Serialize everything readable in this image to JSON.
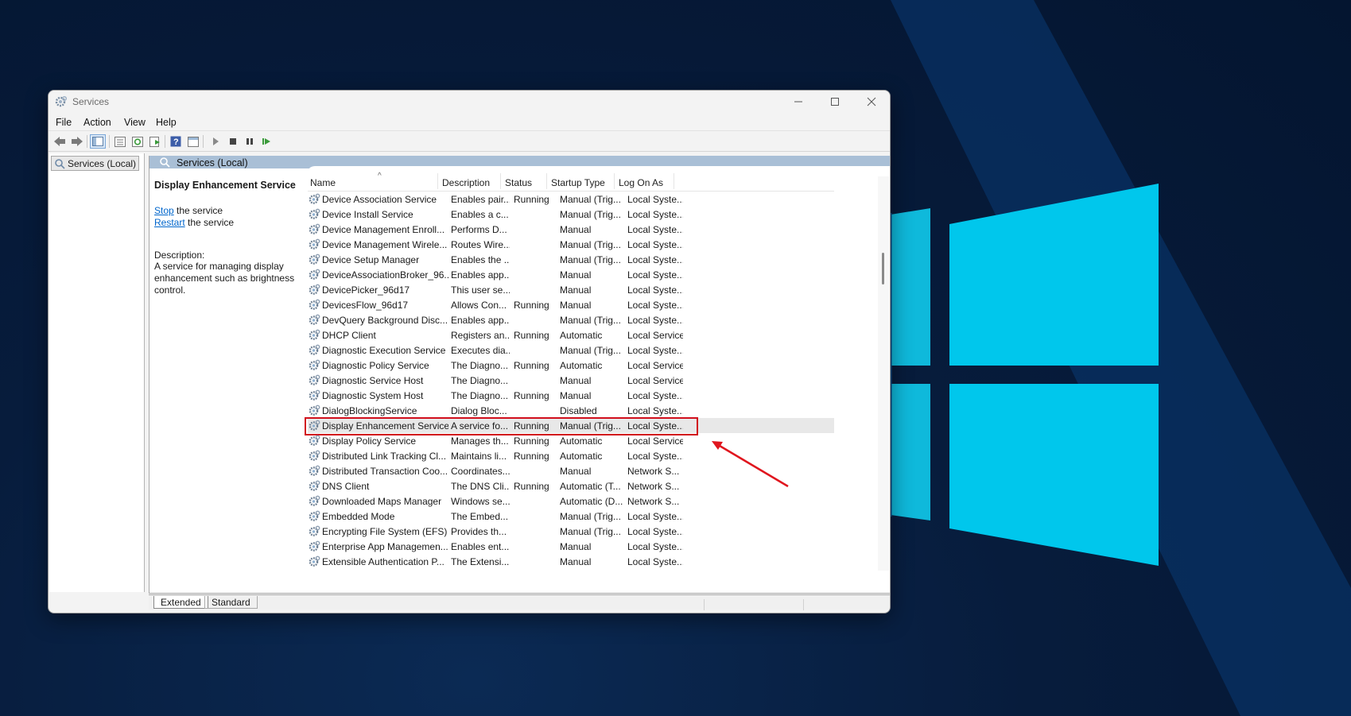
{
  "colors": {
    "accent_blue": "#0066cc",
    "highlight_red": "#d10f1c",
    "desktop_bg": "#041530",
    "logo_cyan": "#00c7ec"
  },
  "window": {
    "title": "Services",
    "icons": {
      "app": "services-gear-icon",
      "minimize": "minimize-icon",
      "maximize": "maximize-icon",
      "close": "close-icon"
    }
  },
  "menu": [
    "File",
    "Action",
    "View",
    "Help"
  ],
  "toolbar": {
    "buttons": [
      "back-icon",
      "forward-icon",
      "show-hide-console-tree-icon",
      "properties-icon",
      "refresh-icon",
      "export-list-icon",
      "help-icon",
      "console-view-icon",
      "start-service-icon",
      "stop-service-icon",
      "pause-service-icon",
      "restart-service-icon"
    ]
  },
  "tree": {
    "root_label": "Services (Local)"
  },
  "pane": {
    "title": "Services (Local)"
  },
  "details": {
    "service_title": "Display Enhancement Service",
    "stop_link": "Stop",
    "stop_suffix": " the service",
    "restart_link": "Restart",
    "restart_suffix": " the service",
    "description_label": "Description:",
    "description": "A service for managing display enhancement such as brightness control."
  },
  "columns": [
    "Name",
    "Description",
    "Status",
    "Startup Type",
    "Log On As"
  ],
  "services": [
    {
      "name": "Device Association Service",
      "desc": "Enables pair...",
      "status": "Running",
      "startup": "Manual (Trig...",
      "logon": "Local Syste..."
    },
    {
      "name": "Device Install Service",
      "desc": "Enables a c...",
      "status": "",
      "startup": "Manual (Trig...",
      "logon": "Local Syste..."
    },
    {
      "name": "Device Management Enroll...",
      "desc": "Performs D...",
      "status": "",
      "startup": "Manual",
      "logon": "Local Syste..."
    },
    {
      "name": "Device Management Wirele...",
      "desc": "Routes Wire...",
      "status": "",
      "startup": "Manual (Trig...",
      "logon": "Local Syste..."
    },
    {
      "name": "Device Setup Manager",
      "desc": "Enables the ...",
      "status": "",
      "startup": "Manual (Trig...",
      "logon": "Local Syste..."
    },
    {
      "name": "DeviceAssociationBroker_96...",
      "desc": "Enables app...",
      "status": "",
      "startup": "Manual",
      "logon": "Local Syste..."
    },
    {
      "name": "DevicePicker_96d17",
      "desc": "This user se...",
      "status": "",
      "startup": "Manual",
      "logon": "Local Syste..."
    },
    {
      "name": "DevicesFlow_96d17",
      "desc": "Allows Con...",
      "status": "Running",
      "startup": "Manual",
      "logon": "Local Syste..."
    },
    {
      "name": "DevQuery Background Disc...",
      "desc": "Enables app...",
      "status": "",
      "startup": "Manual (Trig...",
      "logon": "Local Syste..."
    },
    {
      "name": "DHCP Client",
      "desc": "Registers an...",
      "status": "Running",
      "startup": "Automatic",
      "logon": "Local Service"
    },
    {
      "name": "Diagnostic Execution Service",
      "desc": "Executes dia...",
      "status": "",
      "startup": "Manual (Trig...",
      "logon": "Local Syste..."
    },
    {
      "name": "Diagnostic Policy Service",
      "desc": "The Diagno...",
      "status": "Running",
      "startup": "Automatic",
      "logon": "Local Service"
    },
    {
      "name": "Diagnostic Service Host",
      "desc": "The Diagno...",
      "status": "",
      "startup": "Manual",
      "logon": "Local Service"
    },
    {
      "name": "Diagnostic System Host",
      "desc": "The Diagno...",
      "status": "Running",
      "startup": "Manual",
      "logon": "Local Syste..."
    },
    {
      "name": "DialogBlockingService",
      "desc": "Dialog Bloc...",
      "status": "",
      "startup": "Disabled",
      "logon": "Local Syste..."
    },
    {
      "name": "Display Enhancement Service",
      "desc": "A service fo...",
      "status": "Running",
      "startup": "Manual (Trig...",
      "logon": "Local Syste...",
      "selected": true
    },
    {
      "name": "Display Policy Service",
      "desc": "Manages th...",
      "status": "Running",
      "startup": "Automatic",
      "logon": "Local Service"
    },
    {
      "name": "Distributed Link Tracking Cl...",
      "desc": "Maintains li...",
      "status": "Running",
      "startup": "Automatic",
      "logon": "Local Syste..."
    },
    {
      "name": "Distributed Transaction Coo...",
      "desc": "Coordinates...",
      "status": "",
      "startup": "Manual",
      "logon": "Network S..."
    },
    {
      "name": "DNS Client",
      "desc": "The DNS Cli...",
      "status": "Running",
      "startup": "Automatic (T...",
      "logon": "Network S..."
    },
    {
      "name": "Downloaded Maps Manager",
      "desc": "Windows se...",
      "status": "",
      "startup": "Automatic (D...",
      "logon": "Network S..."
    },
    {
      "name": "Embedded Mode",
      "desc": "The Embed...",
      "status": "",
      "startup": "Manual (Trig...",
      "logon": "Local Syste..."
    },
    {
      "name": "Encrypting File System (EFS)",
      "desc": "Provides th...",
      "status": "",
      "startup": "Manual (Trig...",
      "logon": "Local Syste..."
    },
    {
      "name": "Enterprise App Managemen...",
      "desc": "Enables ent...",
      "status": "",
      "startup": "Manual",
      "logon": "Local Syste..."
    },
    {
      "name": "Extensible Authentication P...",
      "desc": "The Extensi...",
      "status": "",
      "startup": "Manual",
      "logon": "Local Syste..."
    }
  ],
  "tabs": [
    "Extended",
    "Standard"
  ]
}
